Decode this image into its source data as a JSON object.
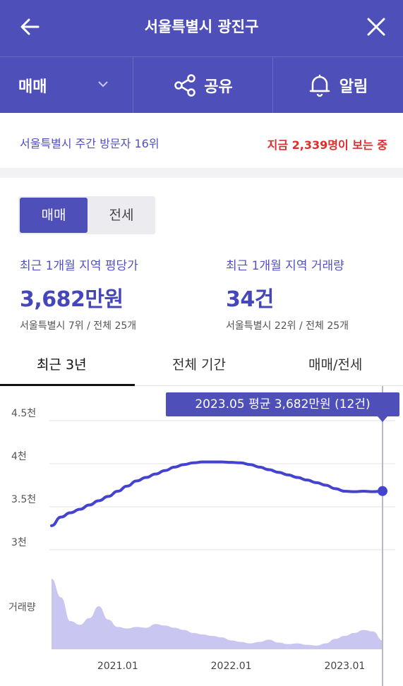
{
  "header": {
    "title": "서울특별시 광진구",
    "back_icon": "arrow-left-icon",
    "close_icon": "close-icon"
  },
  "actions": {
    "trade_label": "매매",
    "share_label": "공유",
    "alarm_label": "알림"
  },
  "info": {
    "rank_text": "서울특별시 주간 방문자 16위",
    "live_text": "지금 2,339명이 보는 중"
  },
  "toggle": {
    "sale": "매매",
    "jeonse": "전세",
    "selected": "매매"
  },
  "stats": [
    {
      "label": "최근 1개월 지역 평당가",
      "value": "3,682만원",
      "sub": "서울특별시 7위 / 전체 25개"
    },
    {
      "label": "최근 1개월 지역 거래량",
      "value": "34건",
      "sub": "서울특별시 22위 / 전체 25개"
    }
  ],
  "tabs": {
    "recent": "최근 3년",
    "all": "전체 기간",
    "trade_jeonse": "매매/전세",
    "selected": "최근 3년"
  },
  "tooltip": "2023.05 평균 3,682만원 (12건)",
  "colors": {
    "accent": "#4f4fb9",
    "line": "#4343cf",
    "volume": "#c9c6f2",
    "live": "#e32b2b"
  },
  "chart_data": {
    "type": "line",
    "ytick_labels": [
      "4.5천",
      "4천",
      "3.5천",
      "3천"
    ],
    "volume_label": "거래량",
    "xtick_labels": [
      "2021.01",
      "2022.01",
      "2023.01"
    ],
    "y_ticks": [
      4500,
      4000,
      3500,
      3000
    ],
    "ylim": [
      3000,
      4500
    ],
    "x_ticks": [
      "2021-01",
      "2022-01",
      "2023-01"
    ],
    "x": [
      "2020-06",
      "2020-07",
      "2020-08",
      "2020-09",
      "2020-10",
      "2020-11",
      "2020-12",
      "2021-01",
      "2021-02",
      "2021-03",
      "2021-04",
      "2021-05",
      "2021-06",
      "2021-07",
      "2021-08",
      "2021-09",
      "2021-10",
      "2021-11",
      "2021-12",
      "2022-01",
      "2022-02",
      "2022-03",
      "2022-04",
      "2022-05",
      "2022-06",
      "2022-07",
      "2022-08",
      "2022-09",
      "2022-10",
      "2022-11",
      "2022-12",
      "2023-01",
      "2023-02",
      "2023-03",
      "2023-04",
      "2023-05"
    ],
    "series": [
      {
        "values": [
          3280,
          3380,
          3430,
          3470,
          3520,
          3570,
          3620,
          3680,
          3740,
          3800,
          3840,
          3880,
          3920,
          3960,
          3990,
          4010,
          4020,
          4020,
          4020,
          4015,
          4010,
          3990,
          3960,
          3930,
          3900,
          3870,
          3840,
          3810,
          3780,
          3750,
          3710,
          3680,
          3675,
          3680,
          3675,
          3682
        ]
      },
      {
        "values": [
          95,
          70,
          38,
          33,
          42,
          58,
          40,
          30,
          28,
          30,
          29,
          34,
          32,
          29,
          26,
          22,
          20,
          18,
          16,
          12,
          10,
          8,
          10,
          13,
          9,
          7,
          8,
          6,
          5,
          8,
          14,
          18,
          22,
          26,
          24,
          12
        ]
      }
    ]
  }
}
